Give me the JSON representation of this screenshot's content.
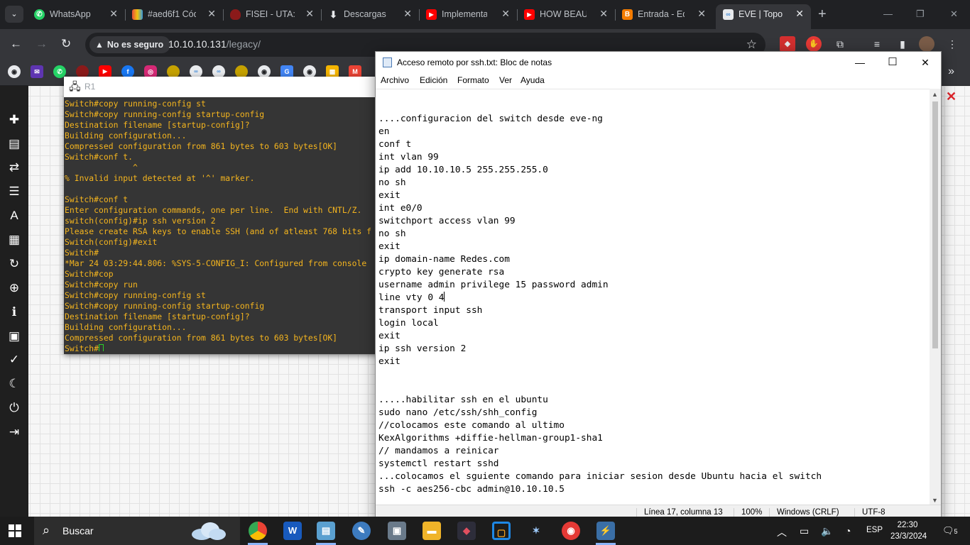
{
  "browser": {
    "tabs": [
      {
        "label": "WhatsApp",
        "icon": "whatsapp-icon",
        "color": "#25d366"
      },
      {
        "label": "#aed6f1 Cód",
        "icon": "colorpicker-icon",
        "color": "#e74c3c"
      },
      {
        "label": "FISEI - UTA: C",
        "icon": "uta-icon",
        "color": "#8b1a1a"
      },
      {
        "label": "Descargas",
        "icon": "download-icon",
        "color": "#e8eaed"
      },
      {
        "label": "Implementac",
        "icon": "youtube-icon",
        "color": "#ff0000"
      },
      {
        "label": "HOW BEAUT",
        "icon": "youtube-icon",
        "color": "#ff0000"
      },
      {
        "label": "Entrada - Edi",
        "icon": "blogger-icon",
        "color": "#f57c00"
      },
      {
        "label": "EVE | Topolo",
        "icon": "eve-icon",
        "color": "#4a90d9",
        "active": true
      }
    ],
    "security_label": "No es seguro",
    "url_host": "10.10.10.131",
    "url_path": "/legacy/"
  },
  "eve": {
    "console_title": "R1",
    "console_lines": [
      "Switch#copy running-config st",
      "Switch#copy running-config startup-config",
      "Destination filename [startup-config]?",
      "Building configuration...",
      "Compressed configuration from 861 bytes to 603 bytes[OK]",
      "Switch#conf t.",
      "              ^",
      "% Invalid input detected at '^' marker.",
      "",
      "Switch#conf t",
      "Enter configuration commands, one per line.  End with CNTL/Z.",
      "switch(config)#ip ssh version 2",
      "Please create RSA keys to enable SSH (and of atleast 768 bits f",
      "Switch(config)#exit",
      "Switch#",
      "*Mar 24 03:29:44.806: %SYS-5-CONFIG_I: Configured from console",
      "Switch#cop",
      "Switch#copy run",
      "Switch#copy running-config st",
      "Switch#copy running-config startup-config",
      "Destination filename [startup-config]?",
      "Building configuration...",
      "Compressed configuration from 861 bytes to 603 bytes[OK]"
    ],
    "console_prompt": "Switch#"
  },
  "notepad": {
    "title": "Acceso remoto por ssh.txt: Bloc de notas",
    "menu": [
      "Archivo",
      "Edición",
      "Formato",
      "Ver",
      "Ayuda"
    ],
    "lines": [
      "....configuracion del switch desde eve-ng",
      "en",
      "conf t",
      "int vlan 99",
      "ip add 10.10.10.5 255.255.255.0",
      "no sh",
      "exit",
      "int e0/0",
      "switchport access vlan 99",
      "no sh",
      "exit",
      "ip domain-name Redes.com",
      "crypto key generate rsa",
      "username admin privilege 15 password admin",
      "line vty 0 4",
      "transport input ssh",
      "login local",
      "exit",
      "ip ssh version 2",
      "exit",
      "",
      "",
      ".....habilitar ssh en el ubuntu",
      "sudo nano /etc/ssh/shh_config",
      "//colocamos este comando al ultimo",
      "KexAlgorithms +diffie-hellman-group1-sha1",
      "// mandamos a reinicar",
      "systemctl restart sshd",
      "...colocamos el sguiente comando para iniciar sesion desde Ubuntu hacia el switch",
      "ssh -c aes256-cbc admin@10.10.10.5"
    ],
    "caret_line": 15,
    "status": {
      "position": "Línea 17, columna 13",
      "zoom": "100%",
      "line_endings": "Windows (CRLF)",
      "encoding": "UTF-8"
    }
  },
  "taskbar": {
    "search_placeholder": "Buscar",
    "language": "ESP",
    "time": "22:30",
    "date": "23/3/2024",
    "notifications": "5"
  }
}
